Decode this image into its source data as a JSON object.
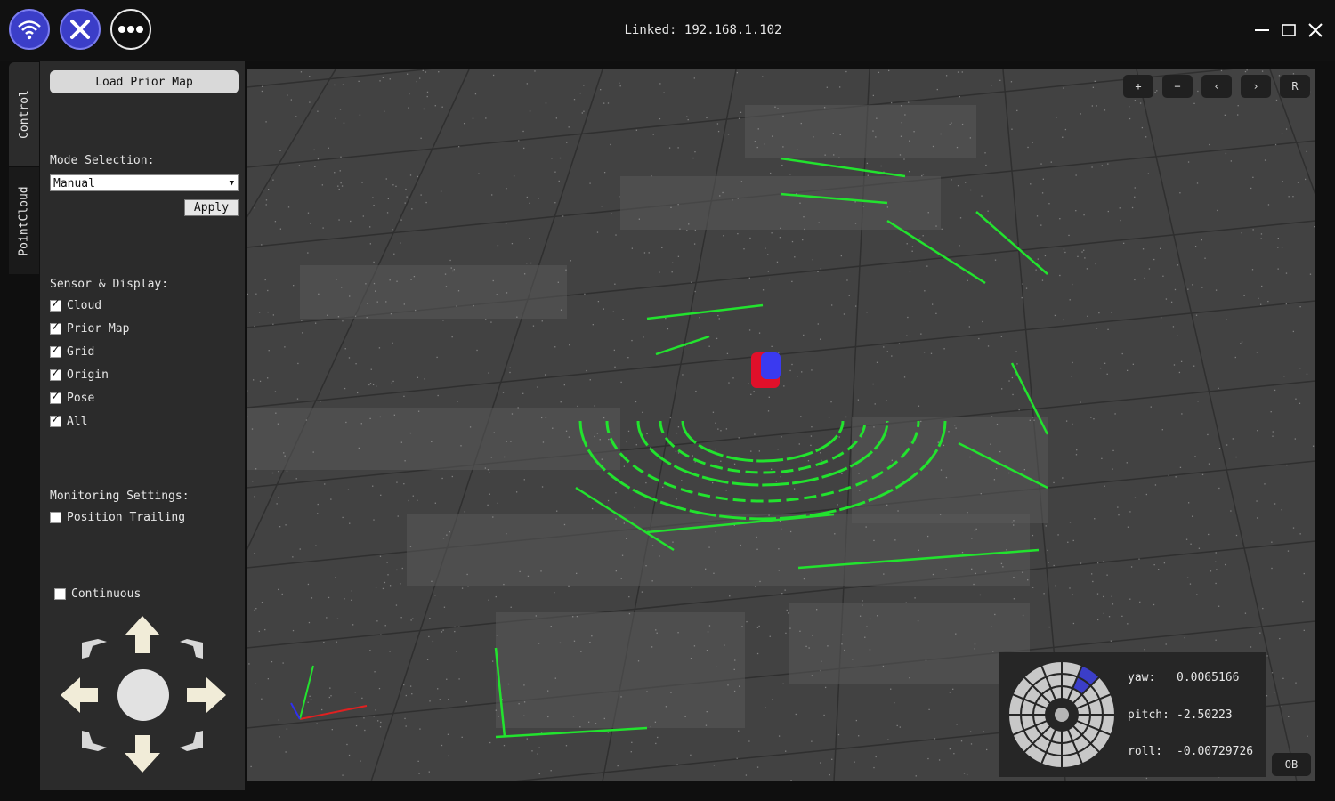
{
  "title": {
    "connection": "Linked: 192.168.1.102"
  },
  "toolbar": {
    "icons": [
      "wifi-icon",
      "close-icon",
      "more-icon"
    ]
  },
  "tabs": [
    {
      "label": "Control"
    },
    {
      "label": "PointCloud"
    }
  ],
  "control": {
    "load_prior_map": "Load Prior Map",
    "mode_label": "Mode Selection:",
    "mode_value": "Manual",
    "apply": "Apply",
    "sensor_label": "Sensor & Display:",
    "sensor_items": [
      {
        "label": "Cloud",
        "checked": true
      },
      {
        "label": "Prior Map",
        "checked": true
      },
      {
        "label": "Grid",
        "checked": true
      },
      {
        "label": "Origin",
        "checked": true
      },
      {
        "label": "Pose",
        "checked": true
      },
      {
        "label": "All",
        "checked": true
      }
    ],
    "monitor_label": "Monitoring Settings:",
    "position_trailing": {
      "label": "Position Trailing",
      "checked": false
    },
    "continuous": {
      "label": "Continuous",
      "checked": false
    }
  },
  "viewport": {
    "buttons": [
      "+",
      "−",
      "‹",
      "›",
      "R"
    ],
    "ob": "OB"
  },
  "pose": {
    "yaw_label": "yaw:",
    "yaw": "0.0065166",
    "pitch_label": "pitch:",
    "pitch": "-2.50223",
    "roll_label": "roll:",
    "roll": "-0.00729726"
  },
  "colors": {
    "accent": "#3b3ec8",
    "cloud_green": "#22e32e",
    "panel": "#2b2b2b"
  }
}
